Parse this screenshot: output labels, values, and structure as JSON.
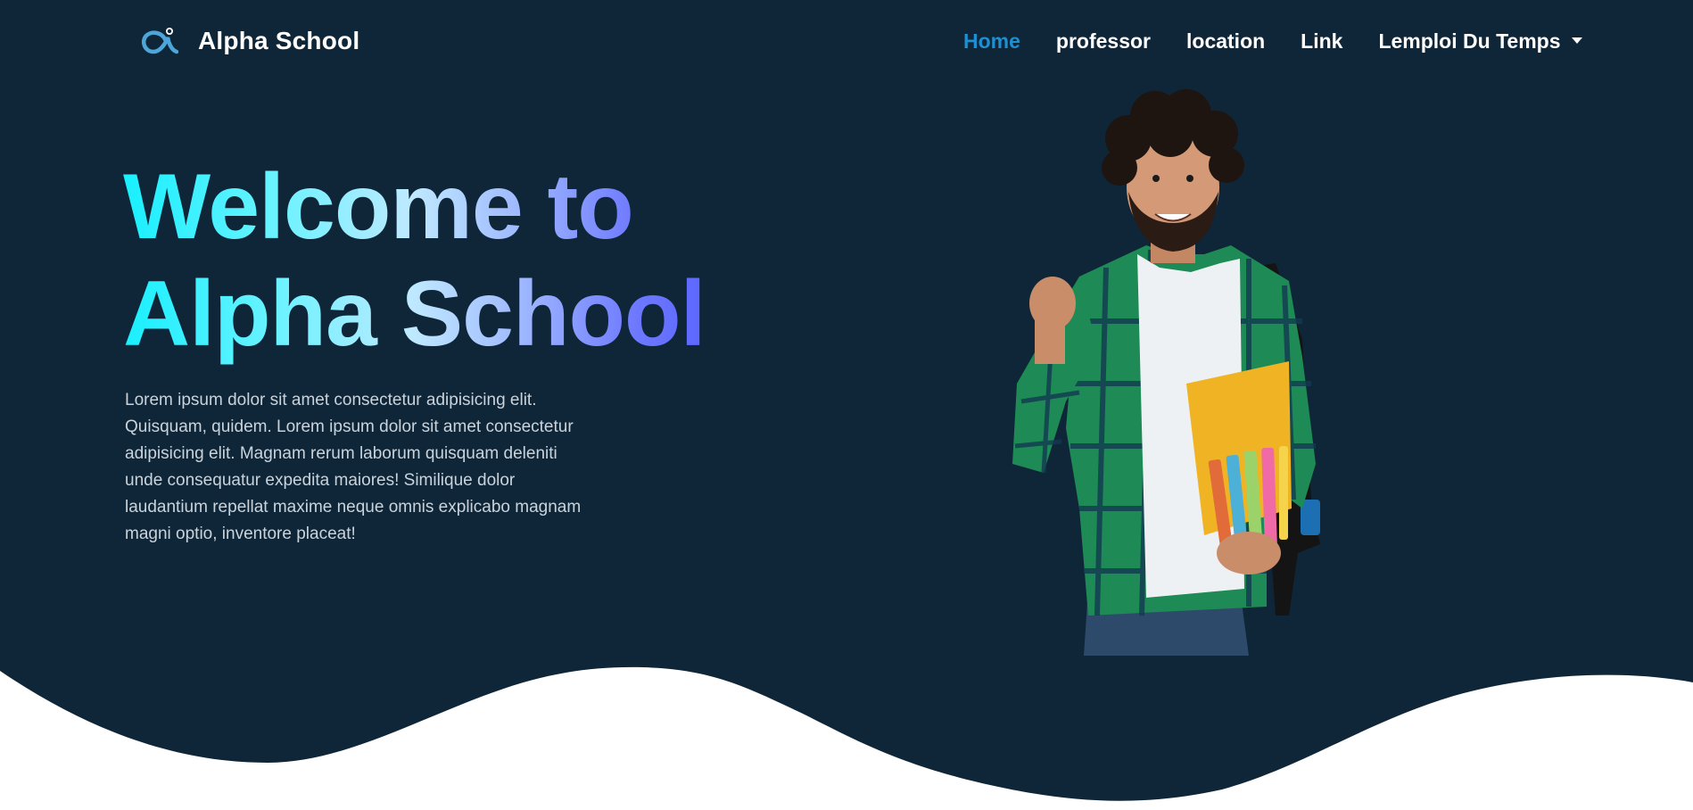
{
  "colors": {
    "background": "#0f2638",
    "wave": "#ffffff",
    "active_link": "#1f8fd0",
    "title_gradient": [
      "#18f0ff",
      "#bfe9ff",
      "#4f58ff"
    ]
  },
  "navbar": {
    "brand": "Alpha School",
    "brand_icon": "alpha-logo-icon",
    "links": [
      {
        "label": "Home",
        "active": true
      },
      {
        "label": "professor",
        "active": false
      },
      {
        "label": "location",
        "active": false
      },
      {
        "label": "Link",
        "active": false
      },
      {
        "label": "Lemploi Du Temps",
        "active": false,
        "dropdown": true
      }
    ],
    "dropdown_icon": "caret-down-icon"
  },
  "hero": {
    "title_line1": "Welcome to",
    "title_line2": "Alpha School",
    "description": "Lorem ipsum dolor sit amet consectetur adipisicing elit. Quisquam, quidem. Lorem ipsum dolor sit amet consectetur adipisicing elit. Magnam rerum laborum quisquam deleniti unde consequatur expedita maiores! Similique dolor laudantium repellat maxime neque omnis explicabo magnam magni optio, inventore placeat!",
    "image": "student-holding-books-illustration"
  }
}
